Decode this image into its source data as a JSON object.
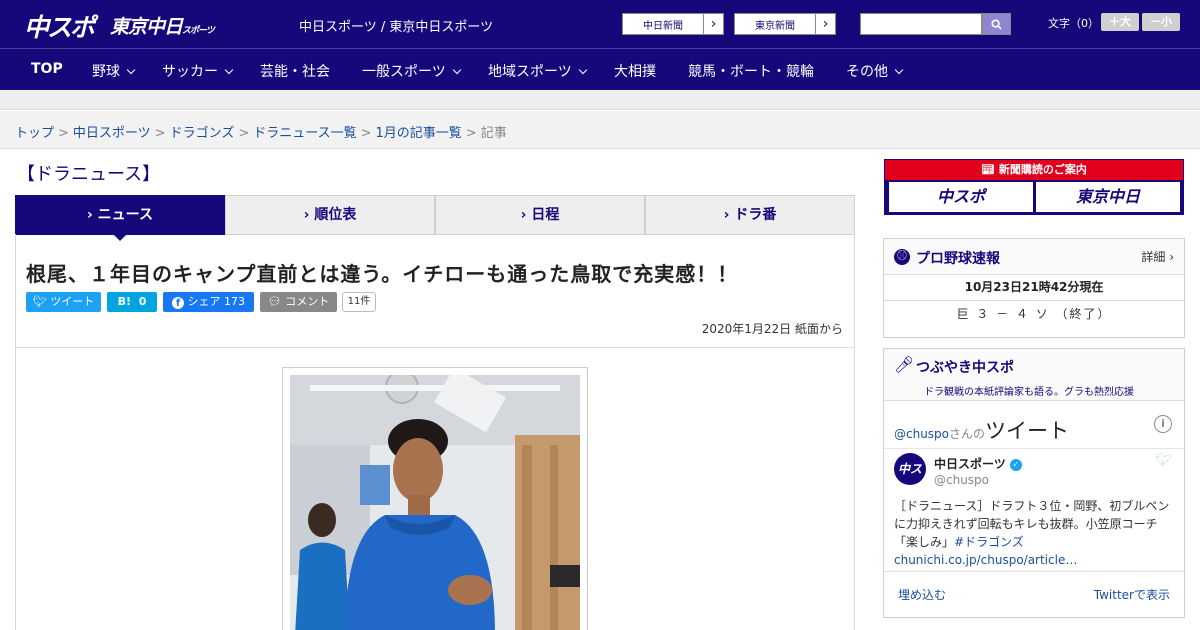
{
  "header": {
    "logo_main": "中スポ",
    "logo_sub": "東京中日",
    "logo_sub_small": "スポーツ",
    "site_name": "中日スポーツ / 東京中日スポーツ",
    "paper_links": [
      "中日新聞",
      "東京新聞"
    ],
    "arrow_glyph": "›",
    "search": {
      "placeholder": "",
      "icon": "search-icon"
    },
    "font_size_label": "文字（0）",
    "font_larger": "＋大",
    "font_smaller": "－小"
  },
  "nav": {
    "items": [
      {
        "label": "TOP",
        "dropdown": false
      },
      {
        "label": "野球",
        "dropdown": true
      },
      {
        "label": "サッカー",
        "dropdown": true
      },
      {
        "label": "芸能・社会",
        "dropdown": false
      },
      {
        "label": "一般スポーツ",
        "dropdown": true
      },
      {
        "label": "地域スポーツ",
        "dropdown": true
      },
      {
        "label": "大相撲",
        "dropdown": false
      },
      {
        "label": "競馬・ボート・競輪",
        "dropdown": false
      },
      {
        "label": "その他",
        "dropdown": true
      }
    ]
  },
  "breadcrumb": {
    "separator": ">",
    "items": [
      "トップ",
      "中日スポーツ",
      "ドラゴンズ",
      "ドラニュース一覧",
      "1月の記事一覧"
    ],
    "current": "記事"
  },
  "section_title": "【ドラニュース】",
  "tabs": [
    {
      "label": "› ニュース",
      "active": true
    },
    {
      "label": "› 順位表",
      "active": false
    },
    {
      "label": "› 日程",
      "active": false
    },
    {
      "label": "› ドラ番",
      "active": false
    }
  ],
  "article": {
    "headline": "根尾、１年目のキャンプ直前とは違う。イチローも通った鳥取で充実感！！",
    "share": {
      "tweet": "ツイート",
      "hatena_logo": "B!",
      "hatena_count": "0",
      "facebook": "シェア",
      "facebook_count": "173",
      "comment": "コメント",
      "comment_count": "11件"
    },
    "date": "2020年1月22日 紙面から"
  },
  "sidebar": {
    "subscribe": {
      "head": "新聞購読のご案内",
      "left": "中スポ",
      "right": "東京中日"
    },
    "baseball": {
      "title": "プロ野球速報",
      "more": "詳細 ›",
      "updated": "10月23日21時42分現在",
      "score": "巨 ３ － ４ ソ （終了）"
    },
    "tweets": {
      "title": "つぶやき中スポ",
      "subtitle": "ドラ観戦の本紙評論家も語る。グラも熱烈応援",
      "account": "@chuspo",
      "account_suffix": "さんの",
      "word": "ツイート",
      "info_glyph": "i",
      "avatar_text": "中スポ",
      "tweet_name": "中日スポーツ",
      "tweet_handle": "@chuspo",
      "tweet_text": "［ドラニュース］ドラフト３位・岡野、初ブルペンに力抑えきれず回転もキレも抜群。小笠原コーチ「楽しみ」",
      "tweet_tag": "#ドラゴンズ",
      "tweet_link": "chunichi.co.jp/chuspo/article…",
      "embed": "埋め込む",
      "view_on_twitter": "Twitterで表示"
    }
  },
  "colors": {
    "brand_navy": "#16087a",
    "link_blue": "#1a4fa0",
    "twitter": "#1da1f2",
    "hatena": "#00a4de",
    "facebook": "#1877f2",
    "subscribe_red": "#e0001e"
  }
}
